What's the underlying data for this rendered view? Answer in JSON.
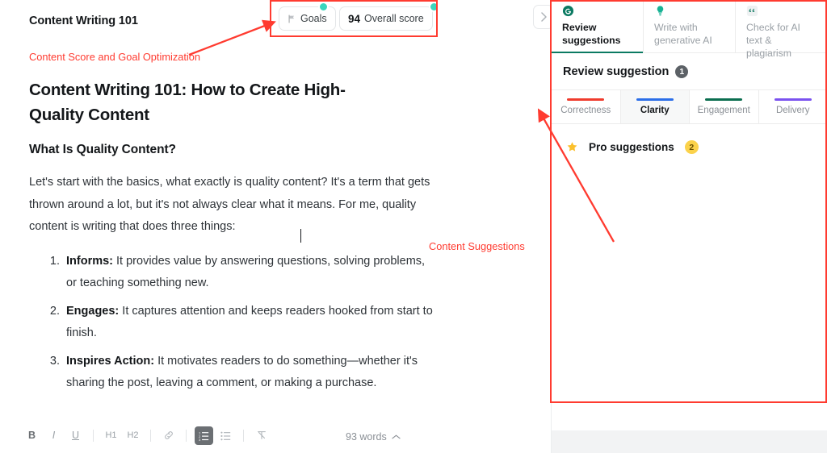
{
  "editor": {
    "doc_title": "Content Writing 101",
    "score_widgets": {
      "goals_label": "Goals",
      "goals_icon": "flag-icon",
      "score_value": "94",
      "score_label": "Overall score",
      "dot_color": "#3ad6bd"
    },
    "article": {
      "h1": "Content Writing 101: How to Create High-Quality Content",
      "h2": "What Is Quality Content?",
      "paragraph": "Let's start with the basics, what exactly is quality content? It's a term that gets thrown around a lot, but it's not always clear what it means. For me, quality content is writing that does three things:",
      "list": [
        {
          "term": "Informs:",
          "text": " It provides value by answering questions, solving problems, or teaching something new."
        },
        {
          "term": "Engages:",
          "text": " It captures attention and keeps readers hooked from start to finish."
        },
        {
          "term": "Inspires Action:",
          "text": " It motivates readers to do something—whether it's sharing the post, leaving a comment, or making a purchase."
        }
      ]
    },
    "toolbar": {
      "bold": "B",
      "italic": "I",
      "underline": "U",
      "h1": "H1",
      "h2": "H2",
      "link": "🔗",
      "numbered_list": "numbered-list-icon",
      "bullet_list": "bullet-list-icon",
      "clear_format": "clear-format-icon",
      "word_count": "93 words",
      "word_count_chevron": "chevron-up-icon"
    },
    "collapse_chevron": "chevron-right-icon"
  },
  "sidebar": {
    "tabs": [
      {
        "label_line1": "Review",
        "label_line2": "suggestions",
        "icon": "grammarly-g-icon",
        "active": true
      },
      {
        "label_line1": "Write with",
        "label_line2": "generative AI",
        "icon": "lightbulb-icon",
        "active": false
      },
      {
        "label_line1": "Check for AI",
        "label_line2": "text & plagiarism",
        "icon": "quote-marks-icon",
        "active": false
      }
    ],
    "review_header": {
      "title": "Review suggestion",
      "count": "1"
    },
    "categories": [
      {
        "label": "Correctness",
        "color": "#ef3b2d",
        "active": false
      },
      {
        "label": "Clarity",
        "color": "#2b6ee8",
        "active": true
      },
      {
        "label": "Engagement",
        "color": "#0b6e4f",
        "active": false
      },
      {
        "label": "Delivery",
        "color": "#7b52ef",
        "active": false
      }
    ],
    "pro": {
      "icon": "star-icon",
      "label": "Pro suggestions",
      "count": "2"
    }
  },
  "annotations": {
    "score_note": "Content Score and Goal Optimization",
    "sidebar_note": "Content Suggestions",
    "color": "#ff3b30"
  }
}
